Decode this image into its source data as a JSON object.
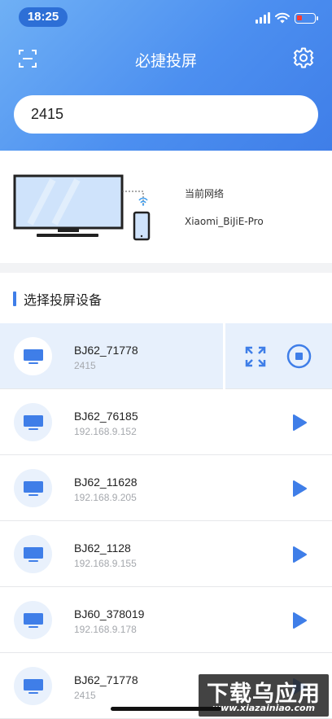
{
  "status_bar": {
    "time": "18:25"
  },
  "header": {
    "title": "必捷投屏"
  },
  "search": {
    "value": "2415"
  },
  "network": {
    "label": "当前网络",
    "name": "Xiaomi_BiJiE-Pro"
  },
  "section": {
    "title": "选择投屏设备"
  },
  "devices": [
    {
      "name": "BJ62_71778",
      "ip": "2415",
      "active": true
    },
    {
      "name": "BJ62_76185",
      "ip": "192.168.9.152"
    },
    {
      "name": "BJ62_11628",
      "ip": "192.168.9.205"
    },
    {
      "name": "BJ62_1128",
      "ip": "192.168.9.155"
    },
    {
      "name": "BJ60_378019",
      "ip": "192.168.9.178"
    },
    {
      "name": "BJ62_71778",
      "ip": "2415"
    }
  ],
  "watermark": {
    "main": "下载乌应用",
    "sub": "www.xiazainiao.com"
  },
  "colors": {
    "accent": "#3f7ee8",
    "header_start": "#6fb0f5",
    "header_end": "#3f7ee8",
    "active_row": "#e7f0fc"
  },
  "icons": {
    "scan": "scan-icon",
    "settings": "gear-icon",
    "tv": "tv-icon",
    "play": "play-icon",
    "expand": "fullscreen-icon",
    "stop": "stop-icon"
  }
}
